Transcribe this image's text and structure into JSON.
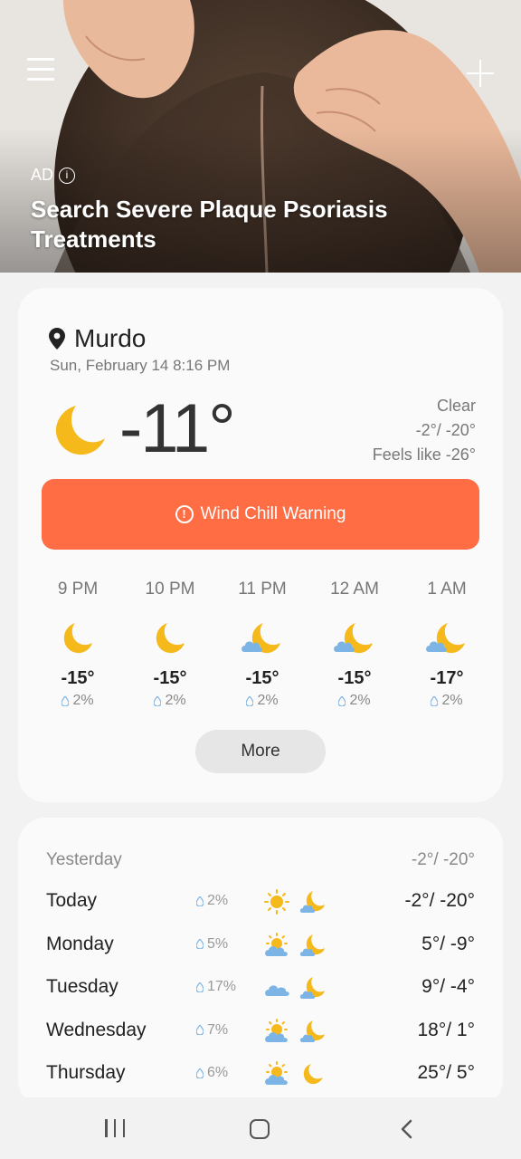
{
  "ad": {
    "label": "AD",
    "info_glyph": "i",
    "title": "Search Severe Plaque Psoriasis Treatments",
    "menu_icon": "menu-icon",
    "add_icon": "add-icon"
  },
  "current": {
    "city": "Murdo",
    "datetime": "Sun, February 14 8:16 PM",
    "temperature": "-11°",
    "condition": "Clear",
    "high_low": "-2°/ -20°",
    "feels_like": "Feels like -26°",
    "condition_icon": "moon-icon"
  },
  "warning": {
    "glyph": "!",
    "label": "Wind Chill Warning",
    "color": "#ff6d44"
  },
  "hourly": [
    {
      "time": "9 PM",
      "icon": "moon-icon",
      "temp": "-15°",
      "precip": "2%"
    },
    {
      "time": "10 PM",
      "icon": "moon-icon",
      "temp": "-15°",
      "precip": "2%"
    },
    {
      "time": "11 PM",
      "icon": "moon-cloud-icon",
      "temp": "-15°",
      "precip": "2%"
    },
    {
      "time": "12 AM",
      "icon": "moon-cloud-icon",
      "temp": "-15°",
      "precip": "2%"
    },
    {
      "time": "1 AM",
      "icon": "moon-cloud-icon",
      "temp": "-17°",
      "precip": "2%"
    }
  ],
  "more_label": "More",
  "daily": {
    "yesterday_label": "Yesterday",
    "yesterday_temps": "-2°/ -20°",
    "days": [
      {
        "name": "Today",
        "precip": "2%",
        "day_icon": "sun-icon",
        "night_icon": "moon-cloud-icon",
        "temps": "-2°/ -20°"
      },
      {
        "name": "Monday",
        "precip": "5%",
        "day_icon": "sun-cloud-icon",
        "night_icon": "moon-cloud-icon",
        "temps": "5°/ -9°"
      },
      {
        "name": "Tuesday",
        "precip": "17%",
        "day_icon": "cloud-icon",
        "night_icon": "moon-cloud-icon",
        "temps": "9°/ -4°"
      },
      {
        "name": "Wednesday",
        "precip": "7%",
        "day_icon": "sun-cloud-icon",
        "night_icon": "moon-cloud-icon",
        "temps": "18°/ 1°"
      },
      {
        "name": "Thursday",
        "precip": "6%",
        "day_icon": "sun-cloud-icon",
        "night_icon": "moon-icon",
        "temps": "25°/ 5°"
      }
    ]
  },
  "colors": {
    "moon": "#f6b91c",
    "cloud": "#7db4e6",
    "sun": "#f6b91c",
    "background": "#f2f2f2",
    "card": "#fafafa"
  }
}
